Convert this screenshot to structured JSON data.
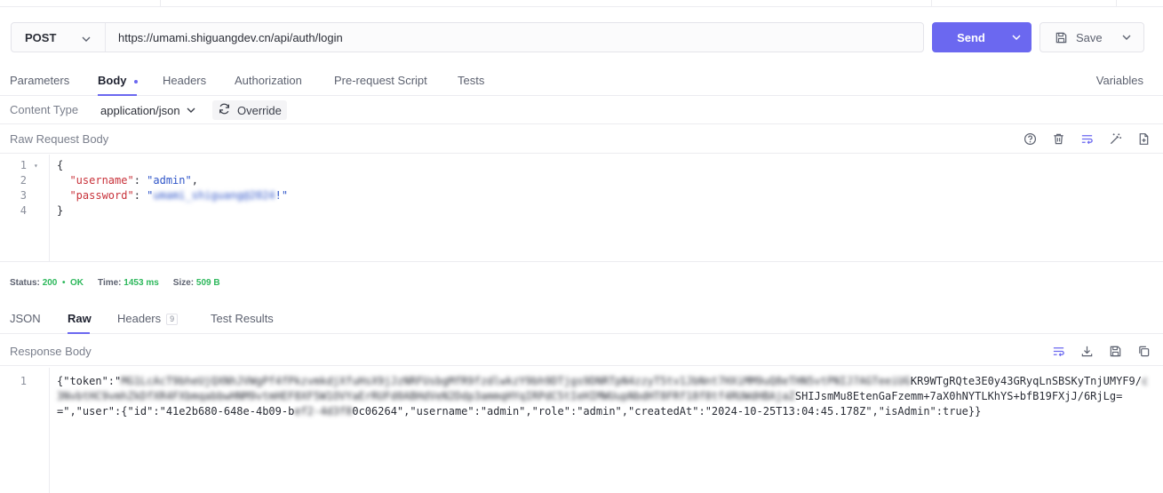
{
  "request": {
    "method": "POST",
    "url": "https://umami.shiguangdev.cn/api/auth/login",
    "send_label": "Send",
    "save_label": "Save"
  },
  "request_tabs": [
    {
      "label": "Parameters"
    },
    {
      "label": "Body"
    },
    {
      "label": "Headers"
    },
    {
      "label": "Authorization"
    },
    {
      "label": "Pre-request Script"
    },
    {
      "label": "Tests"
    }
  ],
  "variables_label": "Variables",
  "content_type": {
    "label": "Content Type",
    "value": "application/json",
    "override_label": "Override"
  },
  "raw_body": {
    "title": "Raw Request Body",
    "line_numbers": [
      "1",
      "2",
      "3",
      "4"
    ],
    "lines": {
      "l1": "{",
      "l2_key": "\"username\"",
      "l2_sep": ": ",
      "l2_val": "\"admin\"",
      "l2_end": ",",
      "l3_key": "\"password\"",
      "l3_sep": ": ",
      "l3_val_open": "\"",
      "l3_val_blurred": "umami_shiguang@2024",
      "l3_val_tail": "!\"",
      "l4": "}"
    }
  },
  "status": {
    "status_label": "Status:",
    "status_code": "200",
    "status_sep": "•",
    "status_text": "OK",
    "time_label": "Time:",
    "time_value": "1453 ms",
    "size_label": "Size:",
    "size_value": "509 B"
  },
  "response_tabs": [
    {
      "label": "JSON"
    },
    {
      "label": "Raw"
    },
    {
      "label": "Headers",
      "badge": "9"
    },
    {
      "label": "Test Results"
    }
  ],
  "response_body": {
    "title": "Response Body",
    "line_number": "1",
    "seg1": "{\"token\":\"",
    "seg1_blur": "MG1LcAcT9bheUjQXNhJVWgPf4fPkzvmkdjXfuHsX9jJzNRFUsbgMfR9fzdlwkzY9bh9DTjgs9DNRTpN4zzyT5tv1JbNnt7HXiMM9uQ8eTHN5vtPNIJ7AGTeeiUG",
    "seg2": "KR9WTgRQte3E0y43GRyqLnSBSKyTnjUMYF9/",
    "seg2_blur": "c3NvbtHC9vmhZkDfXR4FXbmqabbwHNM9vtmHEF8XF5W1OVYaErRUFd0ABHdVeN2Ddp3ammqHYqIRPdC5tIeHIMWUupNbdHT8FRf18f8tf4RUWdHBAjaZ",
    "seg3": "SHIJsmMu8EtenGaFzemm+7aX0hNYTLKhYS+bfB19FXjJ/6RjLg==\",\"user\":{\"id\":\"41e2b680-648e-4b09-b",
    "seg3_blur": "ef2-4d3f8",
    "seg4": "0c06264\",\"username\":\"admin\",\"role\":\"admin\",\"createdAt\":\"2024-10-25T13:04:45.178Z\",\"isAdmin\":true}}"
  },
  "colors": {
    "accent": "#6b68f0",
    "ok": "#2eb85c",
    "json_key": "#c8323a",
    "json_string": "#2f55c8"
  }
}
